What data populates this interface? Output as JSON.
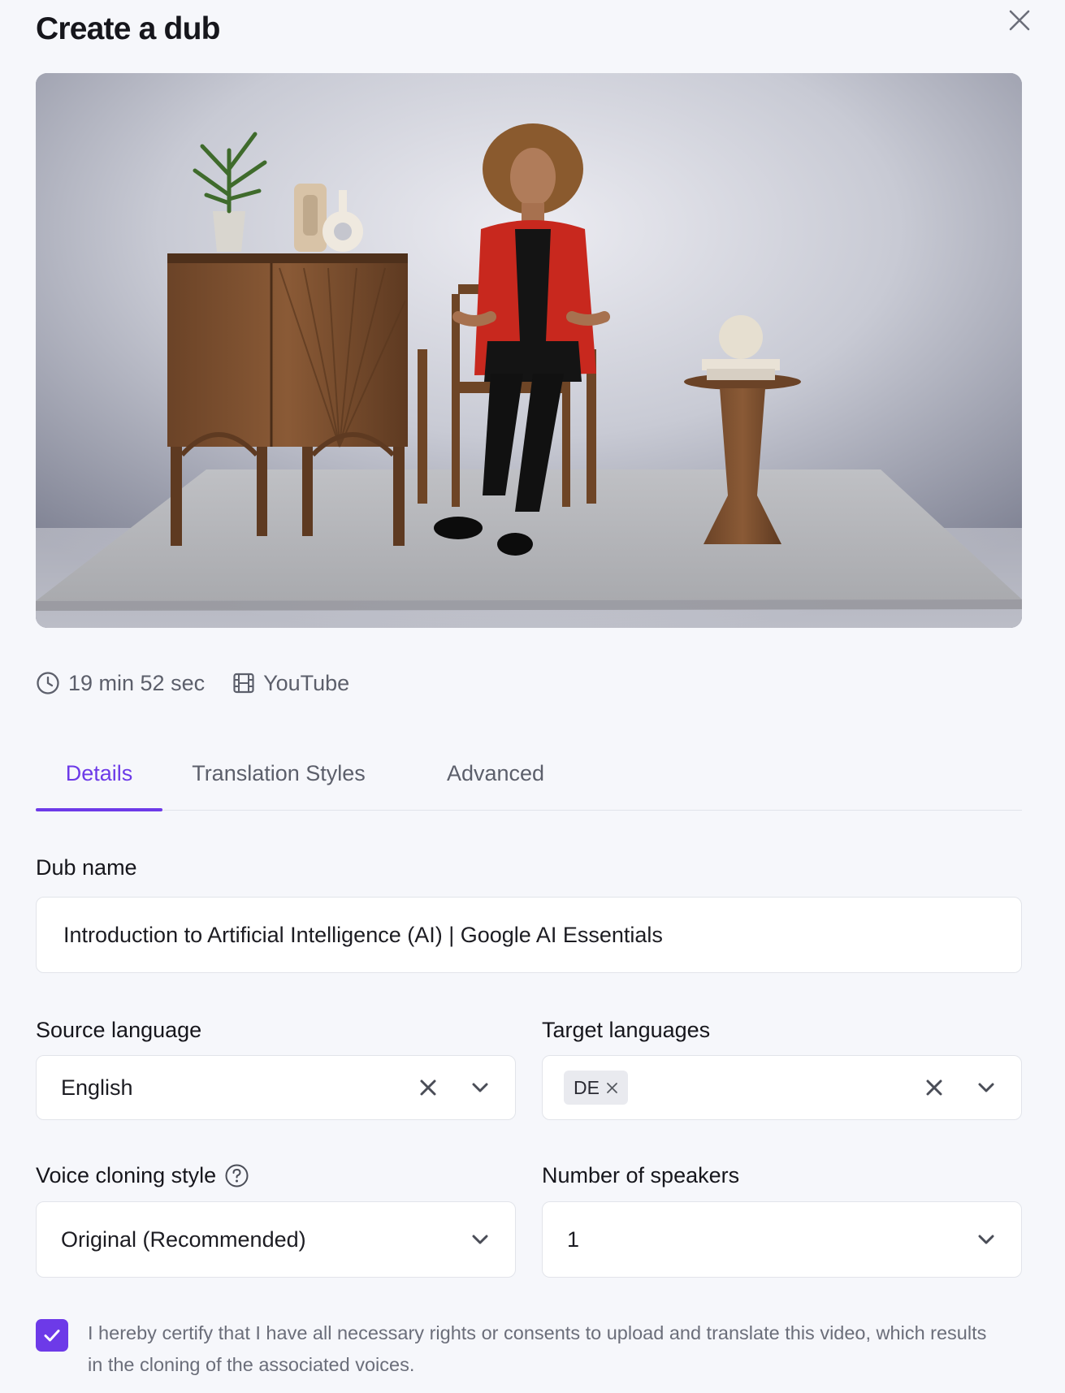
{
  "dialog": {
    "title": "Create a dub",
    "close_icon": "close-icon"
  },
  "video": {
    "thumbnail": "Woman in red blazer seated in a studio with a wooden cabinet, plant, vase and side table"
  },
  "meta": {
    "duration": "19 min 52 sec",
    "duration_icon": "clock-icon",
    "source": "YouTube",
    "source_icon": "film-icon"
  },
  "tabs": [
    {
      "label": "Details",
      "active": true
    },
    {
      "label": "Translation Styles",
      "active": false
    },
    {
      "label": "Advanced",
      "active": false
    }
  ],
  "form": {
    "dub_name": {
      "label": "Dub name",
      "value": "Introduction to Artificial Intelligence (AI) | Google AI Essentials"
    },
    "source_language": {
      "label": "Source language",
      "value": "English"
    },
    "target_languages": {
      "label": "Target languages",
      "chips": [
        "DE"
      ]
    },
    "voice_cloning_style": {
      "label": "Voice cloning style",
      "value": "Original (Recommended)",
      "help_icon": "question-circle-icon"
    },
    "number_of_speakers": {
      "label": "Number of speakers",
      "value": "1"
    }
  },
  "consent": {
    "checked": true,
    "text": "I hereby certify that I have all necessary rights or consents to upload and translate this video, which results in the cloning of the associated voices."
  },
  "colors": {
    "accent": "#6d3ae8",
    "background": "#f6f7fb",
    "muted_text": "#5c5f6b"
  }
}
